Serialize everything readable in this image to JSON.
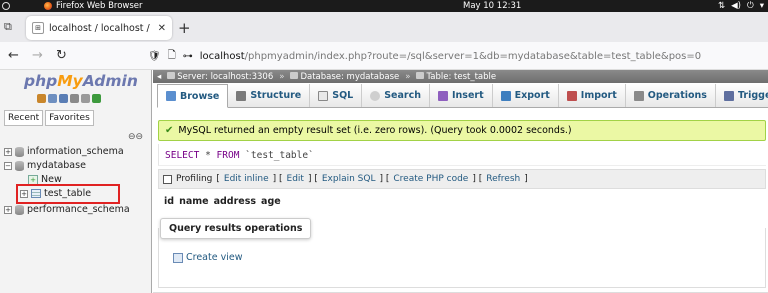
{
  "topbar": {
    "app_name": "Firefox Web Browser",
    "clock": "May 10  12:31"
  },
  "browser": {
    "tab_title": "localhost / localhost / my",
    "url_host": "localhost",
    "url_path": "/phpmyadmin/index.php?route=/sql&server=1&db=mydatabase&table=test_table&pos=0"
  },
  "sidebar": {
    "logo_php": "php",
    "logo_my": "My",
    "logo_admin": "Admin",
    "tab_recent": "Recent",
    "tab_favorites": "Favorites",
    "tree": {
      "info_schema": "information_schema",
      "mydatabase": "mydatabase",
      "new": "New",
      "test_table": "test_table",
      "perf_schema": "performance_schema"
    }
  },
  "breadcrumb": {
    "server": "Server: localhost:3306",
    "database": "Database: mydatabase",
    "table": "Table: test_table"
  },
  "tabs": {
    "browse": "Browse",
    "structure": "Structure",
    "sql": "SQL",
    "search": "Search",
    "insert": "Insert",
    "export": "Export",
    "import": "Import",
    "operations": "Operations",
    "triggers": "Triggers"
  },
  "result": {
    "message": "MySQL returned an empty result set (i.e. zero rows). (Query took 0.0002 seconds.)",
    "sql_select": "SELECT",
    "sql_star": "*",
    "sql_from": "FROM",
    "sql_table": "`test_table`"
  },
  "profiling": {
    "label": "Profiling",
    "open": "[",
    "edit_inline": "Edit inline",
    "sep1": "] [",
    "edit": "Edit",
    "sep2": "] [",
    "explain": "Explain SQL",
    "sep3": "] [",
    "create_php": "Create PHP code",
    "sep4": "] [",
    "refresh": "Refresh",
    "close": "]"
  },
  "columns": [
    "id",
    "name",
    "address",
    "age"
  ],
  "query_ops": {
    "title": "Query results operations",
    "create_view": "Create view"
  },
  "colors": {
    "accent_link": "#235a81",
    "success_bg": "#ebf8a4",
    "highlight_box": "#e02222"
  }
}
